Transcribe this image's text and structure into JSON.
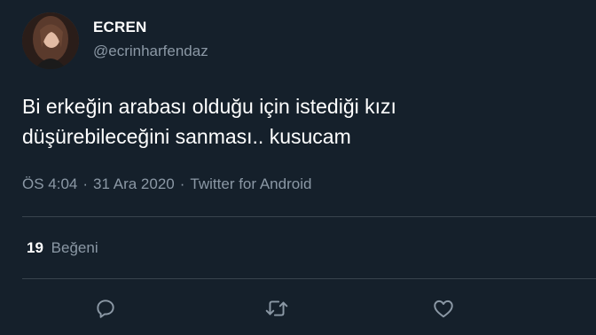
{
  "tweet": {
    "display_name": "ECREN",
    "handle": "@ecrinharfendaz",
    "text_line1": "Bi erkeğin arabası olduğu için istediği kızı",
    "text_line2": "düşürebileceğini sanması.. kusucam",
    "time": "ÖS 4:04",
    "date": "31 Ara 2020",
    "source": "Twitter for Android",
    "separator": "·",
    "likes_count": "19",
    "likes_label": "Beğeni"
  },
  "icons": {
    "reply": "reply-icon",
    "retweet": "retweet-icon",
    "like": "like-icon"
  },
  "colors": {
    "background": "#15202b",
    "muted": "#8b98a5",
    "divider": "#38444d"
  }
}
